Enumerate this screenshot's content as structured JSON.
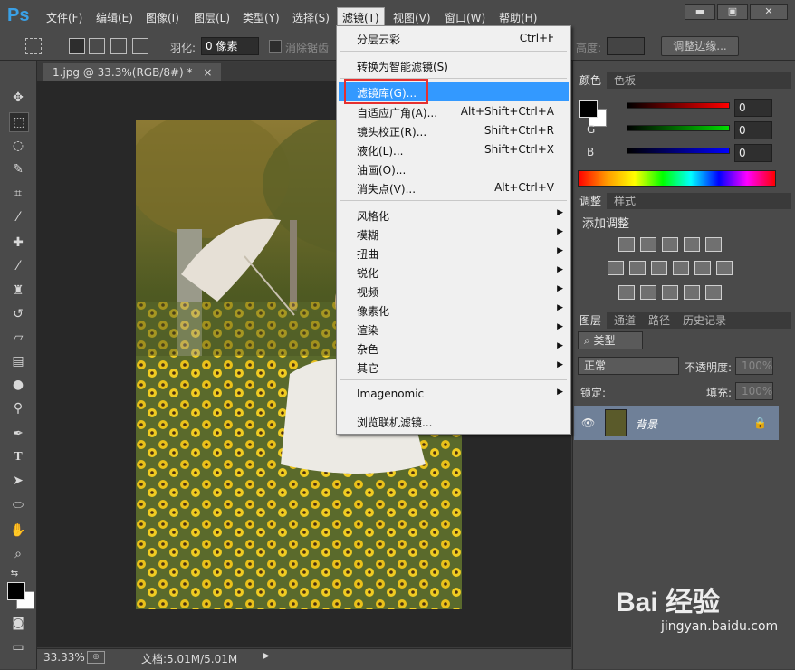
{
  "app": {
    "logo": "Ps"
  },
  "menubar": {
    "items": [
      {
        "label": "文件(F)"
      },
      {
        "label": "编辑(E)"
      },
      {
        "label": "图像(I)"
      },
      {
        "label": "图层(L)"
      },
      {
        "label": "类型(Y)"
      },
      {
        "label": "选择(S)"
      },
      {
        "label": "滤镜(T)"
      },
      {
        "label": "视图(V)"
      },
      {
        "label": "窗口(W)"
      },
      {
        "label": "帮助(H)"
      }
    ]
  },
  "window_controls": {
    "minimize": "▬",
    "restore": "▣",
    "close": "✕"
  },
  "options": {
    "feather_label": "羽化:",
    "feather_value": "0 像素",
    "antialias_label": "消除锯齿",
    "height_label": "高度:",
    "refine_edge": "调整边缘..."
  },
  "document": {
    "tab_title": "1.jpg @ 33.3%(RGB/8#) *",
    "tab_close": "×",
    "zoom": "33.33%",
    "doc_size": "文档:5.01M/5.01M"
  },
  "filter_menu": {
    "items": [
      {
        "label": "分层云彩",
        "shortcut": "Ctrl+F"
      },
      {
        "label": "转换为智能滤镜(S)",
        "shortcut": ""
      },
      {
        "label": "滤镜库(G)...",
        "shortcut": ""
      },
      {
        "label": "自适应广角(A)...",
        "shortcut": "Alt+Shift+Ctrl+A"
      },
      {
        "label": "镜头校正(R)...",
        "shortcut": "Shift+Ctrl+R"
      },
      {
        "label": "液化(L)...",
        "shortcut": "Shift+Ctrl+X"
      },
      {
        "label": "油画(O)...",
        "shortcut": ""
      },
      {
        "label": "消失点(V)...",
        "shortcut": "Alt+Ctrl+V"
      },
      {
        "label": "风格化",
        "shortcut": ""
      },
      {
        "label": "模糊",
        "shortcut": ""
      },
      {
        "label": "扭曲",
        "shortcut": ""
      },
      {
        "label": "锐化",
        "shortcut": ""
      },
      {
        "label": "视频",
        "shortcut": ""
      },
      {
        "label": "像素化",
        "shortcut": ""
      },
      {
        "label": "渲染",
        "shortcut": ""
      },
      {
        "label": "杂色",
        "shortcut": ""
      },
      {
        "label": "其它",
        "shortcut": ""
      },
      {
        "label": "Imagenomic",
        "shortcut": ""
      },
      {
        "label": "浏览联机滤镜...",
        "shortcut": ""
      }
    ]
  },
  "color_panel": {
    "tabs": [
      "颜色",
      "色板"
    ],
    "r_label": "R",
    "g_label": "G",
    "b_label": "B",
    "r": "0",
    "g": "0",
    "b": "0"
  },
  "adjust_panel": {
    "tabs": [
      "调整",
      "样式"
    ],
    "title": "添加调整"
  },
  "layers_panel": {
    "tabs": [
      "图层",
      "通道",
      "路径",
      "历史记录"
    ],
    "filter_kind": "类型",
    "blend_mode": "正常",
    "opacity_label": "不透明度:",
    "opacity_value": "100%",
    "lock_label": "锁定:",
    "fill_label": "填充:",
    "fill_value": "100%",
    "layer_name": "背景"
  },
  "watermark": {
    "text": "Bai 经验",
    "subtext": "jingyan.baidu.com"
  },
  "colors": {
    "menu_highlight": "#3399ff",
    "annotation_box": "#e53030",
    "ps_blue": "#3aa0e6"
  }
}
